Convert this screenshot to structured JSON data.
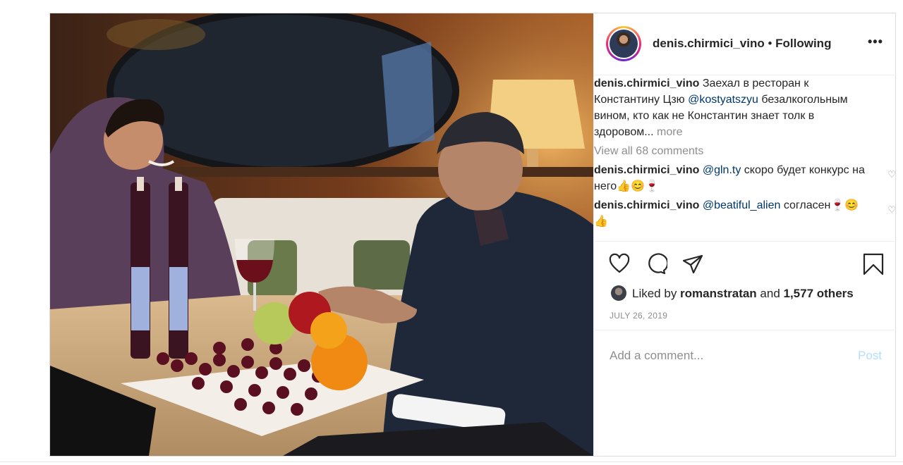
{
  "photo": {
    "alt": "Two men at a restaurant table with bottles of alcohol free wine, fruit and a glass of red wine"
  },
  "header": {
    "username": "denis.chirmici_vino",
    "separator": " • ",
    "follow_status": "Following",
    "more": "•••"
  },
  "caption": {
    "username": "denis.chirmici_vino",
    "text_before": " Заехал в ресторан к Константину Цзю ",
    "mention": "@kostyatszyu",
    "text_after": " безалкогольным вином, кто как не Константин знает толк в здоровом... ",
    "more_link": "more"
  },
  "view_all": "View all 68 comments",
  "comments": [
    {
      "username": "denis.chirmici_vino",
      "mention": "@gln.ty",
      "text": " скоро будет конкурс на него👍😊🍷"
    },
    {
      "username": "denis.chirmici_vino",
      "mention": "@beatiful_alien",
      "text": " согласен🍷😊👍"
    }
  ],
  "likes": {
    "prefix": "Liked by ",
    "liker": "romanstratan",
    "middle": " and ",
    "others": "1,577 others"
  },
  "date": "JULY 26, 2019",
  "add_comment": {
    "placeholder": "Add a comment...",
    "post_label": "Post"
  },
  "colors": {
    "link": "#00376b",
    "muted": "#8e8e8e",
    "post_disabled": "#b2dffc"
  },
  "icons": [
    "heart-icon",
    "comment-icon",
    "share-icon",
    "bookmark-icon",
    "more-icon"
  ]
}
